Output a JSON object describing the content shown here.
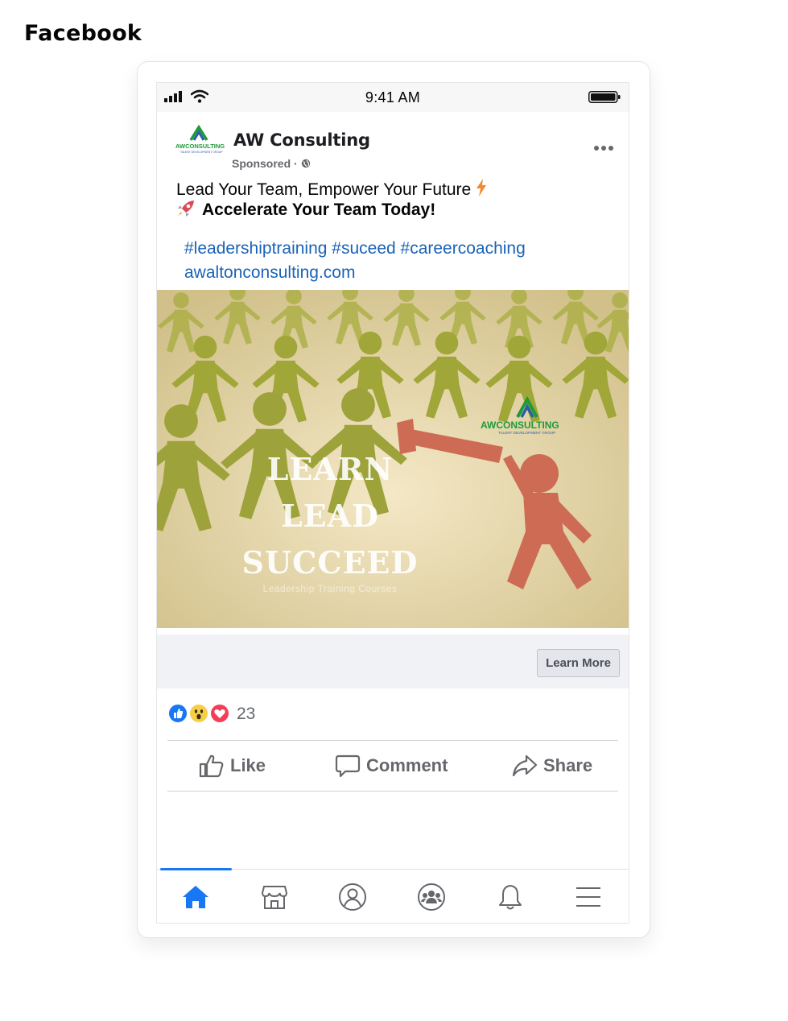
{
  "page": {
    "title": "Facebook"
  },
  "status_bar": {
    "time": "9:41 AM"
  },
  "post": {
    "page_name": "AW Consulting",
    "sponsored_label": "Sponsored · ",
    "text_line1": "Lead Your Team, Empower Your Future",
    "text_line2": "Accelerate Your Team Today!",
    "hashtags": "#leadershiptraining #suceed #careercoaching",
    "link": "awaltonconsulting.com",
    "logo": {
      "brand": "AWCONSULTING",
      "tagline": "TALENT DEVELOPMENT GROUP",
      "brand_color": "#1e9a3a",
      "accent_color": "#2a5caa"
    },
    "image": {
      "headline": [
        "LEARN",
        "LEAD",
        "SUCCEED"
      ],
      "subline": "Leadership Training Courses",
      "figure_color": "#a8ad3e",
      "leader_color": "#cd6b55",
      "background": "#e6d8ad"
    },
    "cta_label": "Learn More",
    "reactions": {
      "count": "23",
      "types": [
        "like-icon",
        "wow-icon",
        "love-icon"
      ]
    },
    "actions": {
      "like": "Like",
      "comment": "Comment",
      "share": "Share"
    }
  },
  "bottom_nav": {
    "items": [
      "home-icon",
      "marketplace-icon",
      "profile-icon",
      "groups-icon",
      "notifications-icon",
      "menu-icon"
    ],
    "active": "home-icon",
    "active_color": "#1877f2"
  }
}
